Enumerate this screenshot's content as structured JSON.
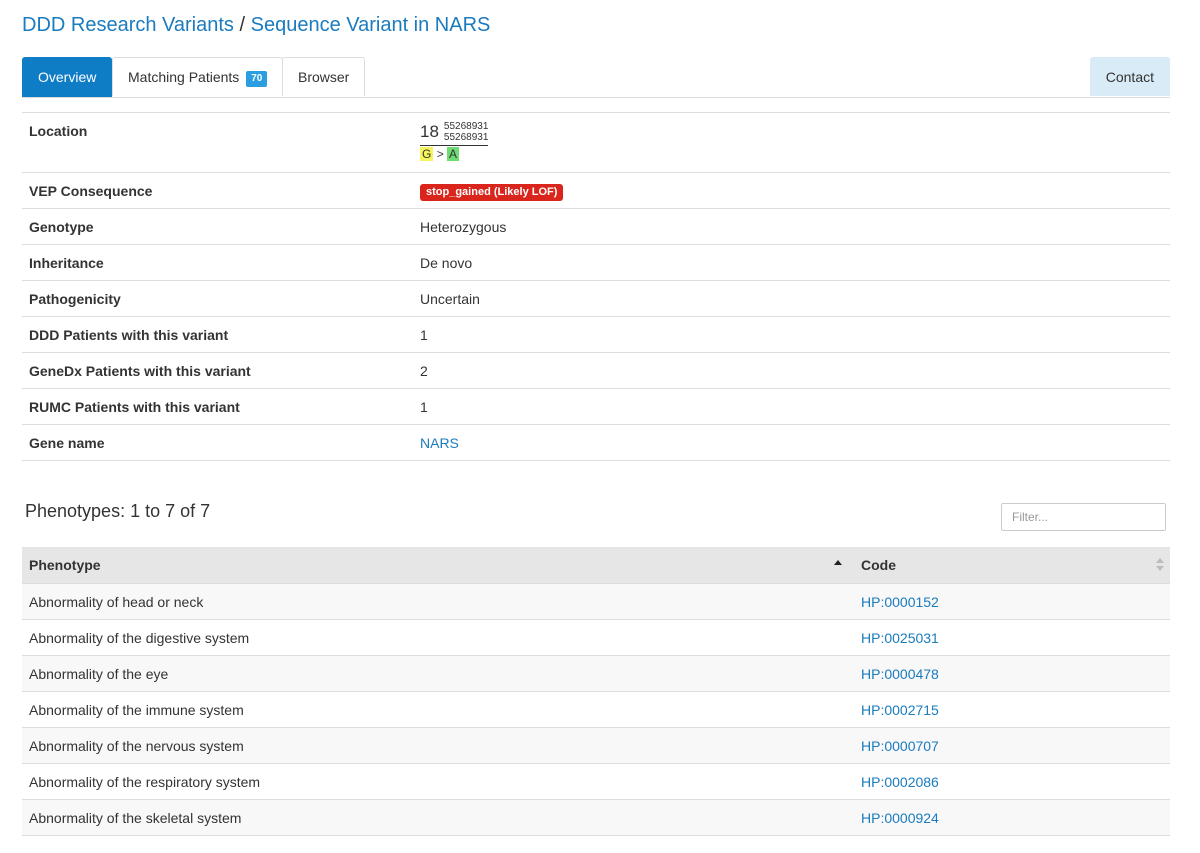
{
  "header": {
    "title_part1": "DDD Research Variants",
    "separator": " / ",
    "title_part2": "Sequence Variant in NARS"
  },
  "tabs": [
    {
      "label": "Overview",
      "active": true
    },
    {
      "label": "Matching Patients",
      "badge": "70"
    },
    {
      "label": "Browser"
    },
    {
      "label": "Contact"
    }
  ],
  "details": {
    "location_label": "Location",
    "location": {
      "chromosome": "18",
      "start": "55268931",
      "end": "55268931",
      "ref": "G",
      "arrow": ">",
      "alt": "A"
    },
    "consequence_label": "VEP Consequence",
    "consequence": "stop_gained (Likely LOF)",
    "genotype_label": "Genotype",
    "genotype": "Heterozygous",
    "inheritance_label": "Inheritance",
    "inheritance": "De novo",
    "pathogenicity_label": "Pathogenicity",
    "pathogenicity": "Uncertain",
    "ddd_label": "DDD Patients with this variant",
    "ddd": "1",
    "genedx_label": "GeneDx Patients with this variant",
    "genedx": "2",
    "rumc_label": "RUMC Patients with this variant",
    "rumc": "1",
    "gene_label": "Gene name",
    "gene": "NARS"
  },
  "phenotypes": {
    "heading": "Phenotypes: 1 to 7 of 7",
    "filter_placeholder": "Filter...",
    "columns": [
      "Phenotype",
      "Code"
    ],
    "rows": [
      {
        "phenotype": "Abnormality of head or neck",
        "code": "HP:0000152"
      },
      {
        "phenotype": "Abnormality of the digestive system",
        "code": "HP:0025031"
      },
      {
        "phenotype": "Abnormality of the eye",
        "code": "HP:0000478"
      },
      {
        "phenotype": "Abnormality of the immune system",
        "code": "HP:0002715"
      },
      {
        "phenotype": "Abnormality of the nervous system",
        "code": "HP:0000707"
      },
      {
        "phenotype": "Abnormality of the respiratory system",
        "code": "HP:0002086"
      },
      {
        "phenotype": "Abnormality of the skeletal system",
        "code": "HP:0000924"
      }
    ]
  },
  "colors": {
    "accent": "#0f7cc6",
    "link": "#1a7bbf",
    "lof": "#d9251c",
    "ref_allele": "#f5f55b",
    "alt_allele": "#6ddc73"
  }
}
